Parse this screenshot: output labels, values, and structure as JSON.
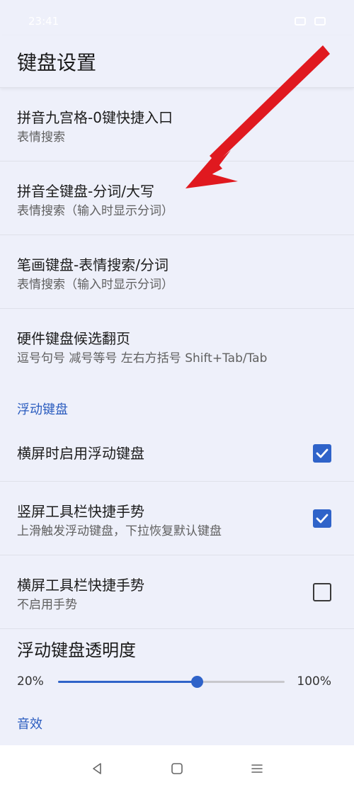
{
  "status_bar": {
    "time": "23:41"
  },
  "header": {
    "title": "键盘设置"
  },
  "items": [
    {
      "title": "拼音九宫格-0键快捷入口",
      "subtitle": "表情搜索"
    },
    {
      "title": "拼音全键盘-分词/大写",
      "subtitle": "表情搜索（输入时显示分词）"
    },
    {
      "title": "笔画键盘-表情搜索/分词",
      "subtitle": "表情搜索（输入时显示分词）"
    },
    {
      "title": "硬件键盘候选翻页",
      "subtitle": "逗号句号 减号等号 左右方括号 Shift+Tab/Tab"
    }
  ],
  "floating_section": {
    "header": "浮动键盘",
    "items": [
      {
        "title": "横屏时启用浮动键盘",
        "checked": true
      },
      {
        "title": "竖屏工具栏快捷手势",
        "subtitle": "上滑触发浮动键盘，下拉恢复默认键盘",
        "checked": true
      },
      {
        "title": "横屏工具栏快捷手势",
        "subtitle": "不启用手势",
        "checked": false
      }
    ]
  },
  "opacity": {
    "title": "浮动键盘透明度",
    "min_label": "20%",
    "max_label": "100%",
    "min": 20,
    "max": 100,
    "value": 69
  },
  "sound_section": {
    "header": "音效"
  },
  "accent_color": "#2f63c9",
  "icons": {
    "back": "back-triangle-icon",
    "home": "home-square-icon",
    "menu": "menu-lines-icon"
  }
}
